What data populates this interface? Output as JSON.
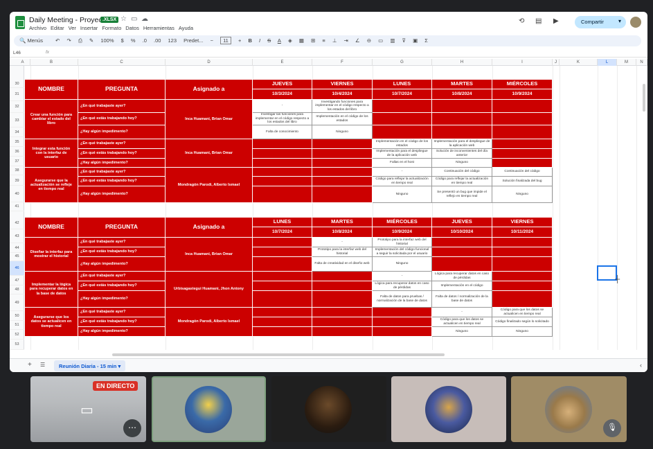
{
  "app": {
    "title": "Daily Meeting - Proyecto",
    "badge": ".XLSX",
    "share": "Compartir",
    "menus": [
      "Archivo",
      "Editar",
      "Ver",
      "Insertar",
      "Formato",
      "Datos",
      "Herramientas",
      "Ayuda"
    ]
  },
  "toolbar": {
    "menus_label": "Menús",
    "zoom": "100%",
    "currency": "$",
    "percent": "%",
    "dec_less": ".0",
    "dec_more": ".00",
    "num_fmt": "123",
    "font": "Predet...",
    "font_size": "11",
    "minus": "−",
    "plus": "+",
    "bold": "B",
    "italic": "I",
    "strike": "S",
    "textcolor": "A"
  },
  "formula": {
    "cellref": "L46",
    "fx": "fx"
  },
  "cols": [
    "A",
    "B",
    "C",
    "D",
    "E",
    "F",
    "G",
    "H",
    "I",
    "J",
    "K",
    "L",
    "M",
    "N"
  ],
  "rows": [
    "30",
    "31",
    "32",
    "33",
    "34",
    "35",
    "36",
    "37",
    "38",
    "39",
    "40",
    "41",
    "42",
    "43",
    "44",
    "45",
    "46",
    "47",
    "48",
    "49",
    "50",
    "51",
    "52",
    "53"
  ],
  "t1": {
    "headers": {
      "nombre": "NOMBRE",
      "pregunta": "PREGUNTA",
      "asignado": "Asignado a"
    },
    "days": [
      "JUEVES",
      "VIERNES",
      "LUNES",
      "MARTES",
      "MIÉRCOLES"
    ],
    "dates": [
      "10/3/2024",
      "10/4/2024",
      "10/7/2024",
      "10/8/2024",
      "10/9/2024"
    ],
    "tasks": [
      {
        "name": "Crear una función para cambiar el estado del libro",
        "assigned": "Inca Huamani, Brian Omar",
        "questions": [
          "¿En qué trabajaste ayer?",
          "¿En qué estás trabajando hoy?",
          "¿Hay algún impedimento?"
        ],
        "cells": [
          [
            "-",
            "Investigando funciones para implementar en el código respecto a los estados del libro",
            "",
            "",
            ""
          ],
          [
            "Investigar las funciones para implementar en el código respecto a los estados del libro",
            "Implementación en el código de los estados",
            "",
            "",
            ""
          ],
          [
            "Falta de conocimiento",
            "Ninguno",
            "",
            "",
            ""
          ]
        ]
      },
      {
        "name": "Integrar esta función con la interfaz de usuario",
        "assigned": "Inca Huamani, Brian Omar",
        "questions": [
          "¿En qué trabajaste ayer?",
          "¿En qué estás trabajando hoy?",
          "¿Hay algún impedimento?"
        ],
        "cells": [
          [
            "",
            "",
            "Implementación en el código de los estados",
            "Implementación para el despliegue de la aplicación web",
            ""
          ],
          [
            "",
            "",
            "Implementación para el despliegue de la aplicación web",
            "Solución de inconvenientes del día anterior",
            ""
          ],
          [
            "",
            "",
            "Fallas en el host",
            "Ninguno",
            ""
          ]
        ]
      },
      {
        "name": "Asegurarse que la actualización se refleje en tiempo real",
        "assigned": "Mondragón Parodi, Alberto Ismael",
        "questions": [
          "¿En qué trabajaste ayer?",
          "¿En qué estás trabajando hoy?",
          "¿Hay algún impedimento?"
        ],
        "cells": [
          [
            "",
            "",
            "-",
            "Continuación del código",
            "Continuación del código"
          ],
          [
            "",
            "",
            "Código para reflejar la actualización en tiempo real",
            "Código para reflejar la actualización en tiempo real",
            "Solución finalizada del bug"
          ],
          [
            "",
            "",
            "Ninguno",
            "Se presentó un bug que impide el reflejo en tiempo real",
            "Ninguno"
          ]
        ]
      }
    ]
  },
  "t2": {
    "headers": {
      "nombre": "NOMBRE",
      "pregunta": "PREGUNTA",
      "asignado": "Asignado a"
    },
    "days": [
      "LUNES",
      "MARTES",
      "MIÉRCOLES",
      "JUEVES",
      "VIERNES"
    ],
    "dates": [
      "10/7/2024",
      "10/8/2024",
      "10/9/2024",
      "10/10/2024",
      "10/11/2024"
    ],
    "tasks": [
      {
        "name": "Diseñar la interfaz para mostrar el historial",
        "assigned": "Inca Huamani, Brian Omar",
        "questions": [
          "¿En qué trabajaste ayer?",
          "¿En qué estás trabajando hoy?",
          "¿Hay algún impedimento?"
        ],
        "cells": [
          [
            "",
            "-",
            "Prototipo para la interfaz web del historial",
            "",
            ""
          ],
          [
            "",
            "Prototipo para la interfaz web del historial",
            "Implementación del código funcional a seguir la solicitada por el usuario",
            "",
            ""
          ],
          [
            "",
            "Falta de creatividad en el diseño web",
            "Ninguno",
            "",
            ""
          ]
        ]
      },
      {
        "name": "Implementar la lógica para recuperar datos en la base de datos",
        "assigned": "Urbisagastegui Huamani, Jhon Antony",
        "questions": [
          "¿En qué trabajaste ayer?",
          "¿En qué estás trabajando hoy?",
          "¿Hay algún impedimento?"
        ],
        "cells": [
          [
            "",
            "",
            "-",
            "Lógica para recuperar datos en caso de pérdidas",
            ""
          ],
          [
            "",
            "",
            "Lógica para recuperar datos en caso de pérdidas",
            "Implementación en el código",
            ""
          ],
          [
            "",
            "",
            "Falta de datos para pruebas / normalización de la base de datos",
            "Falta de datos / normalización de la base de datos",
            ""
          ]
        ]
      },
      {
        "name": "Asegurarse que los datos se actualicen en tiempo real",
        "assigned": "Mondragón Parodi, Alberto Ismael",
        "questions": [
          "¿En qué trabajaste ayer?",
          "¿En qué estás trabajando hoy?",
          "¿Hay algún impedimento?"
        ],
        "cells": [
          [
            "",
            "",
            "",
            "-",
            "Código para que los datos se actualicen en tiempo real"
          ],
          [
            "",
            "",
            "",
            "Código para que los datos se actualicen en tiempo real",
            "Código finalizado según lo solicitado"
          ],
          [
            "",
            "",
            "",
            "Ninguno",
            "Ninguno"
          ]
        ]
      }
    ]
  },
  "sheet_tab": "Reunión Diaria - 15 min",
  "meet": {
    "live": "EN DIRECTO"
  }
}
